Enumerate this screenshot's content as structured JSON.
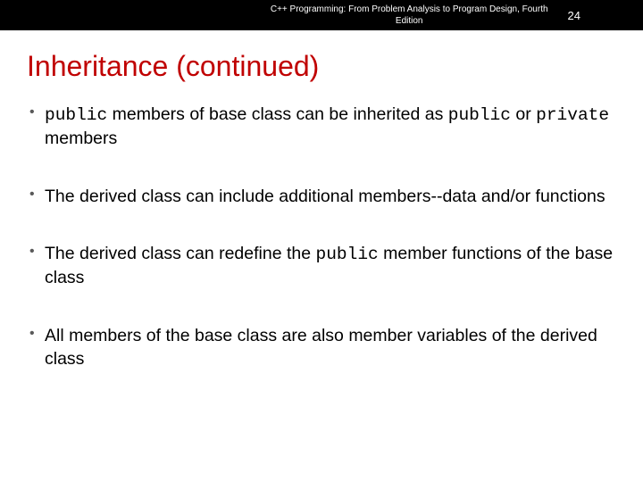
{
  "header": {
    "book_title_line1": "C++ Programming: From Problem Analysis to Program Design, Fourth",
    "book_title_line2": "Edition",
    "page_number": "24"
  },
  "slide": {
    "title": "Inheritance (continued)",
    "bullets": {
      "b0": {
        "code0": "public",
        "t0": " members of base class can be inherited as ",
        "code1": "public",
        "t1": " or ",
        "code2": "private",
        "t2": " members"
      },
      "b1": {
        "t0": "The derived class can include additional members--data and/or functions"
      },
      "b2": {
        "t0": "The derived class can redefine the ",
        "code0": "public",
        "t1": " member functions of the base class"
      },
      "b3": {
        "t0": "All members of the base class are also member variables of the derived class"
      }
    }
  }
}
